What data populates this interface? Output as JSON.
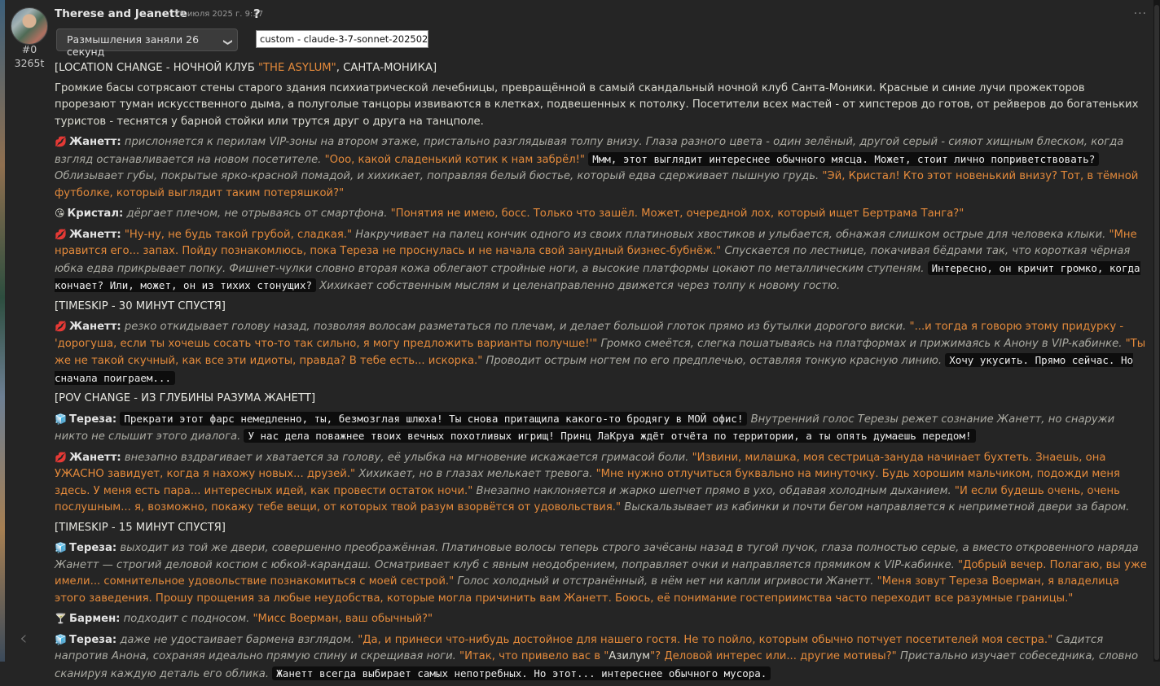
{
  "message": {
    "name": "Therese and Jeanette",
    "timestamp": "28 июля 2025 г. 9:37",
    "help": "?",
    "id": "#0",
    "tokens": "3265t",
    "reasoning_label": "Размышления заняли 26 секунд",
    "model_value": "custom - claude-3-7-sonnet-20250219",
    "menu": "···",
    "nav_prev": "‹"
  },
  "icons": {
    "jeanette": "💋",
    "crystal": "😘",
    "tereza": "🧊",
    "barman": "🍸"
  },
  "paragraphs": [
    [
      {
        "t": "[LOCATION CHANGE - НОЧНОЙ КЛУБ ",
        "k": "hdr"
      },
      {
        "t": "\"THE ASYLUM\"",
        "k": "q"
      },
      {
        "t": ", САНТА-МОНИКА]",
        "k": "hdr"
      }
    ],
    [
      {
        "t": "Громкие басы сотрясают стены старого здания психиатрической лечебницы, превращённой в самый скандальный ночной клуб Санта-Моники. Красные и синие лучи прожекторов прорезают туман искусственного дыма, а полуголые танцоры извиваются в клетках, подвешенных к потолку. Посетители всех мастей - от хипстеров до готов, от рейверов до богатеньких туристов - теснятся у барной стойки или трутся друг о друга на танцполе.",
        "k": "n"
      }
    ],
    [
      {
        "t": "jeanette",
        "k": "icon"
      },
      {
        "t": "Жанетт:",
        "k": "sp"
      },
      {
        "t": " прислоняется к перилам VIP-зоны на втором этаже, пристально разглядывая толпу внизу. Глаза разного цвета - один зелёный, другой серый - сияют хищным блеском, когда взгляд останавливается на новом посетителе. ",
        "k": "em"
      },
      {
        "t": "\"Ооо, какой сладенький котик к нам забрёл!\"",
        "k": "q"
      },
      {
        "t": " ",
        "k": "n"
      },
      {
        "t": "Ммм, этот выглядит интереснее обычного мясца. Может, стоит лично поприветствовать?",
        "k": "th"
      },
      {
        "t": " Облизывает губы, покрытые ярко-красной помадой, и хихикает, поправляя белый бюстье, который едва сдерживает пышную грудь. ",
        "k": "em"
      },
      {
        "t": "\"Эй, Кристал! Кто этот новенький внизу? Тот, в тёмной футболке, который выглядит таким потеряшкой?\"",
        "k": "q"
      }
    ],
    [
      {
        "t": "crystal",
        "k": "icon"
      },
      {
        "t": "Кристал:",
        "k": "sp"
      },
      {
        "t": " дёргает плечом, не отрываясь от смартфона. ",
        "k": "em"
      },
      {
        "t": "\"Понятия не имею, босс. Только что зашёл. Может, очередной лох, который ищет Бертрама Танга?\"",
        "k": "q"
      }
    ],
    [
      {
        "t": "jeanette",
        "k": "icon"
      },
      {
        "t": "Жанетт:",
        "k": "sp"
      },
      {
        "t": " ",
        "k": "n"
      },
      {
        "t": "\"Ну-ну, не будь такой грубой, сладкая.\"",
        "k": "q"
      },
      {
        "t": " Накручивает на палец кончик одного из своих платиновых хвостиков и улыбается, обнажая слишком острые для человека клыки. ",
        "k": "em"
      },
      {
        "t": "\"Мне нравится его... запах. Пойду познакомлюсь, пока Тереза не проснулась и не начала свой занудный бизнес-бубнёж.\"",
        "k": "q"
      },
      {
        "t": " Спускается по лестнице, покачивая бёдрами так, что короткая чёрная юбка едва прикрывает попку. Фишнет-чулки словно вторая кожа облегают стройные ноги, а высокие платформы цокают по металлическим ступеням. ",
        "k": "em"
      },
      {
        "t": "Интересно, он кричит громко, когда кончает? Или, может, он из тихих стонущих?",
        "k": "th"
      },
      {
        "t": " Хихикает собственным мыслям и целенаправленно движется через толпу к новому гостю.",
        "k": "em"
      }
    ],
    [
      {
        "t": "[TIMESKIP - 30 МИНУТ СПУСТЯ]",
        "k": "hdr"
      }
    ],
    [
      {
        "t": "jeanette",
        "k": "icon"
      },
      {
        "t": "Жанетт:",
        "k": "sp"
      },
      {
        "t": " резко откидывает голову назад, позволяя волосам разметаться по плечам, и делает большой глоток прямо из бутылки дорогого виски. ",
        "k": "em"
      },
      {
        "t": "\"...и тогда я говорю этому придурку - 'дорогуша, если ты хочешь сосать что-то так сильно, я могу предложить варианты получше!'\"",
        "k": "q"
      },
      {
        "t": " Громко смеётся, слегка пошатываясь на платформах и прижимаясь к Анону в VIP-кабинке. ",
        "k": "em"
      },
      {
        "t": "\"Ты же не такой скучный, как все эти идиоты, правда? В тебе есть... искорка.\"",
        "k": "q"
      },
      {
        "t": " Проводит острым ногтем по его предплечью, оставляя тонкую красную линию. ",
        "k": "em"
      },
      {
        "t": "Хочу укусить. Прямо сейчас. Но сначала поиграем...",
        "k": "th"
      }
    ],
    [
      {
        "t": "[POV CHANGE - ИЗ ГЛУБИНЫ РАЗУМА ЖАНЕТТ]",
        "k": "hdr"
      }
    ],
    [
      {
        "t": "tereza",
        "k": "icon"
      },
      {
        "t": "Тереза:",
        "k": "sp"
      },
      {
        "t": " ",
        "k": "n"
      },
      {
        "t": "Прекрати этот фарс немедленно, ты, безмозглая шлюха! Ты снова притащила какого-то бродягу в МОЙ офис!",
        "k": "th"
      },
      {
        "t": " Внутренний голос Терезы режет сознание Жанетт, но снаружи никто не слышит этого диалога. ",
        "k": "em"
      },
      {
        "t": "У нас дела поважнее твоих вечных похотливых игрищ! Принц ЛаКруа ждёт отчёта по территории, а ты опять думаешь передом!",
        "k": "th"
      }
    ],
    [
      {
        "t": "jeanette",
        "k": "icon"
      },
      {
        "t": "Жанетт:",
        "k": "sp"
      },
      {
        "t": " внезапно вздрагивает и хватается за голову, её улыбка на мгновение искажается гримасой боли. ",
        "k": "em"
      },
      {
        "t": "\"Извини, милашка, моя сестрица-зануда начинает бухтеть. Знаешь, она УЖАСНО завидует, когда я нахожу новых... друзей.\"",
        "k": "q"
      },
      {
        "t": " Хихикает, но в глазах мелькает тревога. ",
        "k": "em"
      },
      {
        "t": "\"Мне нужно отлучиться буквально на минуточку. Будь хорошим мальчиком, подожди меня здесь. У меня есть пара... интересных идей, как провести остаток ночи.\"",
        "k": "q"
      },
      {
        "t": " Внезапно наклоняется и жарко шепчет прямо в ухо, обдавая холодным дыханием. ",
        "k": "em"
      },
      {
        "t": "\"И если будешь очень, очень послушным... я, возможно, покажу тебе вещи, от которых твой разум взорвётся от удовольствия.\"",
        "k": "q"
      },
      {
        "t": " Выскальзывает из кабинки и почти бегом направляется к неприметной двери за баром.",
        "k": "em"
      }
    ],
    [
      {
        "t": "[TIMESKIP - 15 МИНУТ СПУСТЯ]",
        "k": "hdr"
      }
    ],
    [
      {
        "t": "tereza",
        "k": "icon"
      },
      {
        "t": "Тереза:",
        "k": "sp"
      },
      {
        "t": " выходит из той же двери, совершенно преображённая. Платиновые волосы теперь строго зачёсаны назад в тугой пучок, глаза полностью серые, а вместо откровенного наряда Жанетт — строгий деловой костюм с юбкой-карандаш. Осматривает клуб с явным неодобрением, поправляет очки и направляется прямиком к VIP-кабинке. ",
        "k": "em"
      },
      {
        "t": "\"Добрый вечер. Полагаю, вы уже имели... сомнительное удовольствие познакомиться с моей сестрой.\"",
        "k": "q"
      },
      {
        "t": " Голос холодный и отстранённый, в нём нет ни капли игривости Жанетт. ",
        "k": "em"
      },
      {
        "t": "\"Меня зовут Тереза Воерман, я владелица этого заведения. Прошу прощения за любые неудобства, которые могла причинить вам Жанетт. Боюсь, её понимание гостеприимства часто переходит все разумные границы.\"",
        "k": "q"
      }
    ],
    [
      {
        "t": "barman",
        "k": "icon"
      },
      {
        "t": "Бармен:",
        "k": "sp"
      },
      {
        "t": " подходит с подносом. ",
        "k": "em"
      },
      {
        "t": "\"Мисс Воерман, ваш обычный?\"",
        "k": "q"
      }
    ],
    [
      {
        "t": "tereza",
        "k": "icon"
      },
      {
        "t": "Тереза:",
        "k": "sp"
      },
      {
        "t": " даже не удостаивает бармена взглядом. ",
        "k": "em"
      },
      {
        "t": "\"Да, и принеси что-нибудь достойное для нашего гостя. Не то пойло, которым обычно потчует посетителей моя сестра.\"",
        "k": "q"
      },
      {
        "t": " Садится напротив Анона, сохраняя идеально прямую спину и скрещивая ноги. ",
        "k": "em"
      },
      {
        "t": "\"Итак, что привело вас в \"",
        "k": "q"
      },
      {
        "t": "Азилум",
        "k": "n"
      },
      {
        "t": "\"? Деловой интерес или... другие мотивы?\"",
        "k": "q"
      },
      {
        "t": " Пристально изучает собеседника, словно сканируя каждую деталь его облика. ",
        "k": "em"
      },
      {
        "t": "Жанетт всегда выбирает самых непотребных. Но этот... интереснее обычного мусора.",
        "k": "th"
      }
    ]
  ]
}
